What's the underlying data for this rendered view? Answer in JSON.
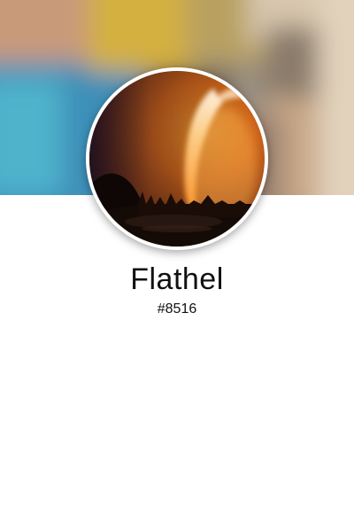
{
  "profile": {
    "display_name": "Flathel",
    "tag": "#8516"
  },
  "banner": {
    "image": "blurred-photo",
    "colors": [
      "#c9a15a",
      "#4fa3c4",
      "#d9c18a",
      "#b07a55",
      "#e8d6b8"
    ]
  },
  "avatar": {
    "image": "fire-tornado-at-night",
    "colors": [
      "#f08a1c",
      "#5a2a14",
      "#1a0d08"
    ]
  }
}
